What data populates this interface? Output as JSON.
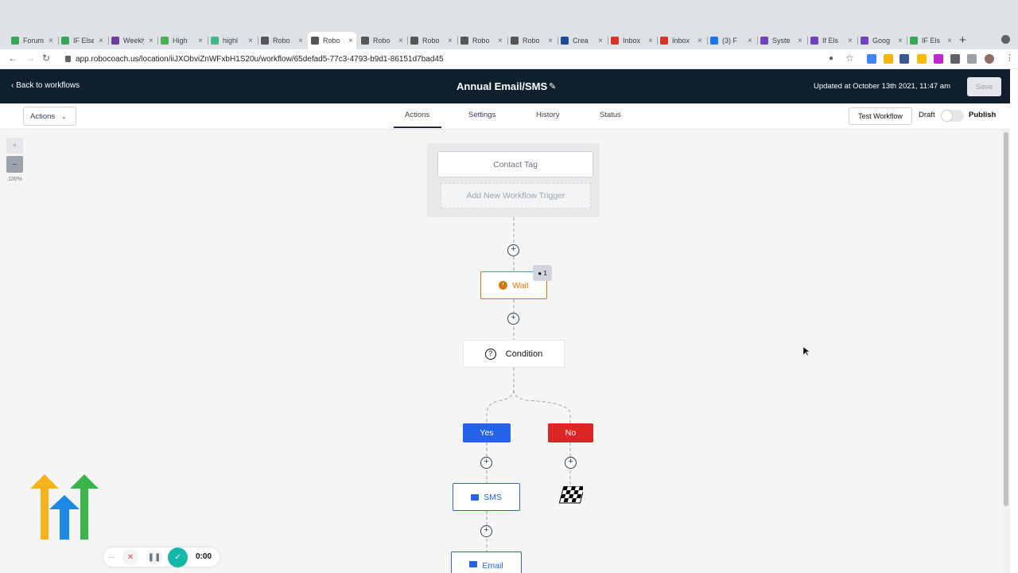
{
  "browser": {
    "tabs": [
      {
        "label": "Forum",
        "color": "#34a853"
      },
      {
        "label": "IF Else",
        "color": "#34a853"
      },
      {
        "label": "Weekly",
        "color": "#6b3fa0"
      },
      {
        "label": "High",
        "color": "#4caf50"
      },
      {
        "label": "highl",
        "color": "#41b883"
      },
      {
        "label": "Robo",
        "color": "#555555"
      },
      {
        "label": "Robo",
        "color": "#555555",
        "active": true
      },
      {
        "label": "Robo",
        "color": "#555555"
      },
      {
        "label": "Robo",
        "color": "#555555"
      },
      {
        "label": "Robo",
        "color": "#555555"
      },
      {
        "label": "Robo",
        "color": "#555555"
      },
      {
        "label": "Crea",
        "color": "#1a4c9c"
      },
      {
        "label": "Inbox",
        "color": "#d93025"
      },
      {
        "label": "Inbox",
        "color": "#d93025"
      },
      {
        "label": "(3) F",
        "color": "#1877f2"
      },
      {
        "label": "Syste",
        "color": "#6f42c1"
      },
      {
        "label": "If Els",
        "color": "#6f42c1"
      },
      {
        "label": "Goog",
        "color": "#6f42c1"
      },
      {
        "label": "IF Els",
        "color": "#34a853"
      }
    ],
    "url": "app.robocoach.us/location/iiJXObviZnWFxbH1S20u/workflow/65defad5-77c3-4793-b9d1-86151d7bad45"
  },
  "header": {
    "back_label": "Back to workflows",
    "workflow_name": "Annual Email/SMS",
    "updated_text": "Updated at October 13th 2021, 11:47 am",
    "save_label": "Save"
  },
  "toolbar": {
    "actions_label": "Actions",
    "tabs": [
      "Actions",
      "Settings",
      "History",
      "Status"
    ],
    "active_tab": "Actions",
    "test_workflow_label": "Test Workflow",
    "draft_label": "Draft",
    "publish_label": "Publish"
  },
  "canvas": {
    "zoom_in": "+",
    "zoom_out": "−",
    "zoom_level": "100%",
    "trigger": "Contact Tag",
    "add_trigger": "Add New Workflow Trigger",
    "wait_label": "Wait",
    "wait_count": "1",
    "condition_label": "Condition",
    "yes_label": "Yes",
    "no_label": "No",
    "sms_label": "SMS",
    "email_label": "Email",
    "plus": "+"
  },
  "recorder": {
    "more": "···",
    "time": "0:00"
  }
}
